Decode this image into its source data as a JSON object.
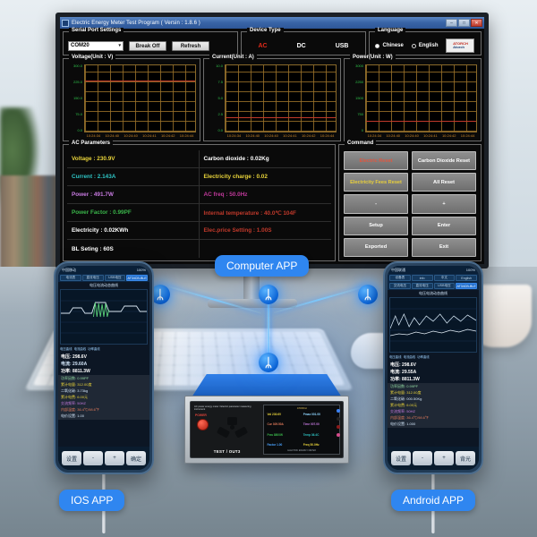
{
  "window": {
    "title": "Electric Energy Meter Test Program ( Versin : 1.8.6 )",
    "buttons": {
      "minimize": "–",
      "maximize": "□",
      "close": "✕"
    }
  },
  "serial_port": {
    "legend": "Serial Port Settings",
    "port_value": "COM20",
    "dropdown_arrow": "▾",
    "break_off_label": "Break Off",
    "refresh_label": "Refresh"
  },
  "device_type": {
    "legend": "Device Type",
    "options": [
      "AC",
      "DC",
      "USB"
    ],
    "selected": "AC"
  },
  "language": {
    "legend": "Language",
    "options": [
      "Chinese",
      "English"
    ],
    "selected": "Chinese",
    "brand_line1": "ATORCH",
    "brand_line2": "Atorch"
  },
  "charts": [
    {
      "legend": "Voltage(Unit : V)",
      "type": "line",
      "title": "Voltage(Unit : V)",
      "ylabel": "V",
      "yticks": [
        "300.0",
        "225.0",
        "150.0",
        "75.0",
        "0.0"
      ],
      "ylim": [
        0,
        300
      ],
      "xticks": [
        "10:24:34",
        "10:24:40",
        "10:24:40",
        "10:24:41",
        "10:24:42",
        "10:24:44"
      ],
      "series": [
        {
          "name": "Voltage",
          "color": "#c0392b",
          "value": 230.9,
          "values": [
            230.9,
            230.9,
            230.9,
            230.9,
            230.9,
            230.9
          ]
        }
      ],
      "grid": true
    },
    {
      "legend": "Current(Unit : A)",
      "type": "line",
      "title": "Current(Unit : A)",
      "ylabel": "A",
      "yticks": [
        "10.0",
        "7.5",
        "5.0",
        "2.5",
        "0.0"
      ],
      "ylim": [
        0,
        10
      ],
      "xticks": [
        "10:24:34",
        "10:24:40",
        "10:24:40",
        "10:24:41",
        "10:24:42",
        "10:24:44"
      ],
      "series": [
        {
          "name": "Current",
          "color": "#c0392b",
          "value": 2.143,
          "values": [
            2.143,
            2.143,
            2.143,
            2.143,
            2.143,
            2.143
          ]
        }
      ],
      "grid": true
    },
    {
      "legend": "Power(Unit : W)",
      "type": "line",
      "title": "Power(Unit : W)",
      "ylabel": "W",
      "yticks": [
        "3000",
        "2250",
        "1500",
        "750",
        "0"
      ],
      "ylim": [
        0,
        3000
      ],
      "xticks": [
        "10:24:34",
        "10:24:40",
        "10:24:40",
        "10:24:41",
        "10:24:42",
        "10:24:44"
      ],
      "series": [
        {
          "name": "Power",
          "color": "#c0392b",
          "value": 491.7,
          "values": [
            491.7,
            491.7,
            491.7,
            491.7,
            491.7,
            491.7
          ]
        }
      ],
      "grid": true
    }
  ],
  "ac_parameters": {
    "legend": "AC Parameters",
    "cells": [
      {
        "text": "Voltage : 230.9V",
        "color": "#e8d33a"
      },
      {
        "text": "Carbon dioxide : 0.02Kg",
        "color": "#ffffff"
      },
      {
        "text": "Current : 2.143A",
        "color": "#2ec4c4"
      },
      {
        "text": "Electricity charge : 0.02",
        "color": "#e8d33a"
      },
      {
        "text": "Power : 491.7W",
        "color": "#c77ae0"
      },
      {
        "text": "AC freq : 50.0Hz",
        "color": "#c0399b"
      },
      {
        "text": "Power Factor : 0.99PF",
        "color": "#3ab54a"
      },
      {
        "text": "Internal temperature : 40.0℃ 104F",
        "color": "#c0392b"
      },
      {
        "text": "Electricity : 0.02KWh",
        "color": "#ffffff"
      },
      {
        "text": "Elec.price Setting : 1.00S",
        "color": "#c0392b"
      },
      {
        "text": "BL Seting : 60S",
        "color": "#ffffff"
      },
      {
        "text": "",
        "color": "#ffffff"
      }
    ]
  },
  "command": {
    "legend": "Command",
    "buttons": [
      {
        "label": "Electric Reset",
        "style": "c-red"
      },
      {
        "label": "Carbon Dioxide Reset",
        "style": ""
      },
      {
        "label": "Electricity Fees Reset",
        "style": "c-yellow"
      },
      {
        "label": "All Reset",
        "style": ""
      },
      {
        "label": "-",
        "style": ""
      },
      {
        "label": "+",
        "style": ""
      },
      {
        "label": "Setup",
        "style": ""
      },
      {
        "label": "Enter",
        "style": ""
      },
      {
        "label": "Exported",
        "style": ""
      },
      {
        "label": "Exit",
        "style": ""
      }
    ]
  },
  "badges": {
    "computer": "Computer APP",
    "ios": "IOS APP",
    "android": "Android APP"
  },
  "phone_ios": {
    "status_left": "中国移动",
    "status_right": "100%",
    "tabs": [
      "电流表",
      "直流电压",
      "USB电压",
      "AT34CB-BLE"
    ],
    "selected_tab": "AT34CB-BLE",
    "chart_title": "电压电流动态曲线",
    "legend": [
      "电压曲线",
      "电流曲线",
      "功率曲线"
    ],
    "values": [
      {
        "label": "电压: 298.6V",
        "color": "#ffffff"
      },
      {
        "label": "电流: 29.60A",
        "color": "#cfe2f5"
      },
      {
        "label": "功率: 8811.3W",
        "color": "#ffffff"
      }
    ],
    "rows": [
      {
        "label": "功率因数: 0.99PF",
        "color": "#8fd6a0"
      },
      {
        "label": "累计电量: 312.00度",
        "color": "#e8d33a"
      },
      {
        "label": "二氧化碳: 3.73kg",
        "color": "#cfe2f5"
      },
      {
        "label": "累计电费: 6.00元",
        "color": "#e8d33a"
      },
      {
        "label": "交流频率: 50HZ",
        "color": "#c77ae0"
      },
      {
        "label": "内部温度: 36.4℃/98.6℉",
        "color": "#e07a5a"
      },
      {
        "label": "电价设置: 1.00",
        "color": "#cfe2f5"
      }
    ],
    "keys": [
      "设置",
      "-",
      "+",
      "确定"
    ]
  },
  "phone_android": {
    "status_left": "中国联通",
    "status_right": "100%",
    "menu": [
      "设备表",
      "info",
      "中文",
      "English"
    ],
    "tabs": [
      "交流电压",
      "直流电压",
      "USB电压",
      "AT34CB-BLE"
    ],
    "selected_tab": "AT34CB-BLE",
    "chart_title": "电压电流动态曲线",
    "legend": [
      "电压曲线",
      "电流曲线",
      "功率曲线"
    ],
    "values": [
      {
        "label": "电压: 298.6V",
        "color": "#ffffff"
      },
      {
        "label": "电流: 29.55A",
        "color": "#ffffff"
      },
      {
        "label": "功率: 8811.3W",
        "color": "#ffffff"
      }
    ],
    "rows": [
      {
        "label": "功率因数: 0.99PF",
        "color": "#8fd6a0"
      },
      {
        "label": "累计电量: 312.00度",
        "color": "#e8d33a"
      },
      {
        "label": "二氧化碳: 000.50Kg",
        "color": "#cfe2f5"
      },
      {
        "label": "累计电费: 6.00元",
        "color": "#e8d33a"
      },
      {
        "label": "交流频率: 50HZ",
        "color": "#c77ae0"
      },
      {
        "label": "内部温度: 36.4℃/98.6℉",
        "color": "#e07a5a"
      },
      {
        "label": "电价设置: 1.000",
        "color": "#cfe2f5"
      }
    ],
    "keys": [
      "设置",
      "-",
      "+",
      "背光"
    ]
  },
  "meter": {
    "caption": "AC power energy meter / Electric parameter measuring instrument",
    "power_label": "POWER",
    "outlet_label": "TEST / OUT3",
    "screen_title": "ATORCH",
    "readings": [
      {
        "label": "Vol  230.6V",
        "color": "#e8d33a"
      },
      {
        "label": "Pmax 001.00",
        "color": "#8fd6ff"
      },
      {
        "label": "Cur  029.50A",
        "color": "#e07a5a"
      },
      {
        "label": "Time 007.00",
        "color": "#c77ae0"
      },
      {
        "label": "Pow  8800W",
        "color": "#3ab54a"
      },
      {
        "label": "Temp 36.4C",
        "color": "#2ec4c4"
      },
      {
        "label": "Factor 1.00",
        "color": "#4aa3ff"
      },
      {
        "label": "Freq 50.0Hz",
        "color": "#e8d33a"
      }
    ],
    "footer": "ELECTRIC ENERGY METER"
  },
  "bluetooth": {
    "glyph": "ᛦ"
  },
  "colors": {
    "accent_blue": "#2f86f0",
    "window_blue": "#2d5697",
    "grid_orange": "#8a6a2a",
    "trace_red": "#c0392b",
    "tick_green": "#2fc24a"
  }
}
